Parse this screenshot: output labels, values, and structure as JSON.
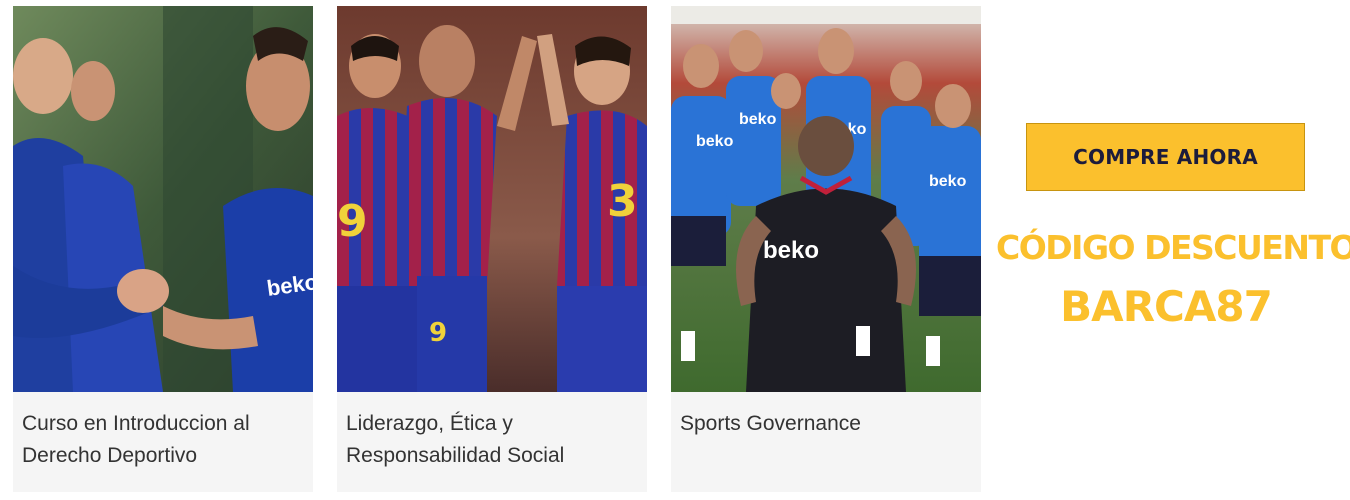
{
  "courses": [
    {
      "title": "Curso en Introduccion al Derecho Deportivo",
      "photo": "players-handshake-photo"
    },
    {
      "title": "Liderazgo, Ética y Responsabilidad Social",
      "photo": "players-high-five-photo"
    },
    {
      "title": "Sports Governance",
      "photo": "coach-team-huddle-photo"
    }
  ],
  "cta": {
    "label": "COMPRE AHORA"
  },
  "promo": {
    "label": "CÓDIGO DESCUENTO:",
    "code": "BARCA87"
  },
  "colors": {
    "accent": "#fbc02d",
    "button_text": "#1c1c3c",
    "caption_text": "#333333",
    "card_bg": "#f5f5f5"
  }
}
